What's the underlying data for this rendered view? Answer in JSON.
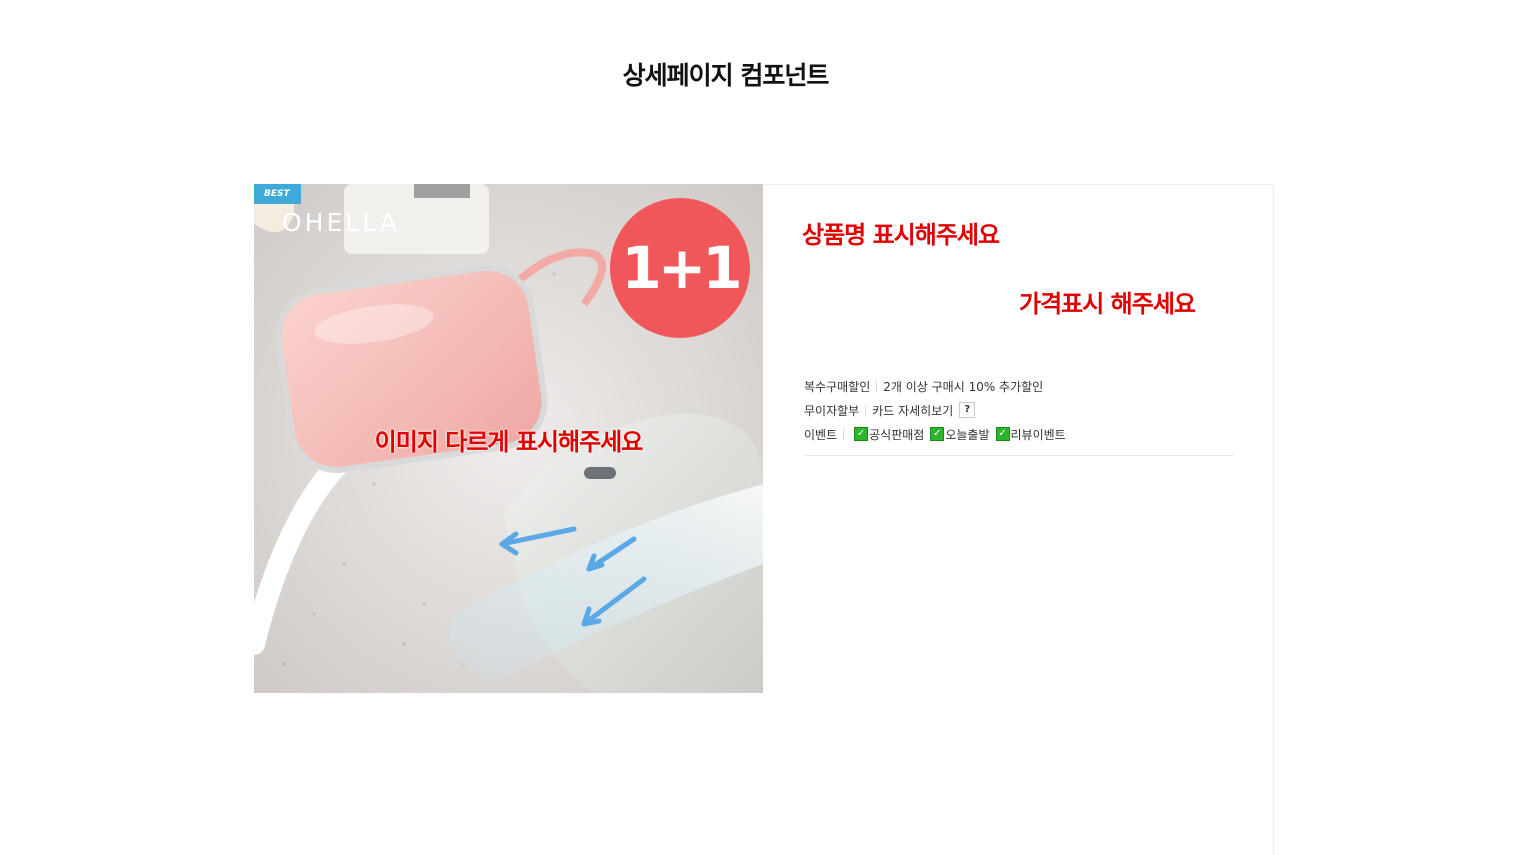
{
  "page": {
    "title": "상세페이지 컴포넌트"
  },
  "image": {
    "badge": "BEST",
    "brand": "OHELLA",
    "promo": "1+1",
    "note": "이미지 다르게 표시해주세요"
  },
  "product": {
    "name": "상품명 표시해주세요",
    "price": "가격표시 해주세요"
  },
  "info": {
    "discount_label": "복수구매할인",
    "discount_value": "2개 이상 구매시 10% 추가할인",
    "installment_label": "무이자할부",
    "installment_value": "카드 자세히보기",
    "help": "?",
    "event_label": "이벤트",
    "events": [
      "공식판매점",
      "오늘출발",
      "리뷰이벤트"
    ],
    "check_mark": "✓"
  },
  "colors": {
    "accent_red": "#e00000",
    "promo_circle": "#f0575a",
    "best_badge": "#3fa9d8",
    "check_green": "#2ab52a"
  }
}
